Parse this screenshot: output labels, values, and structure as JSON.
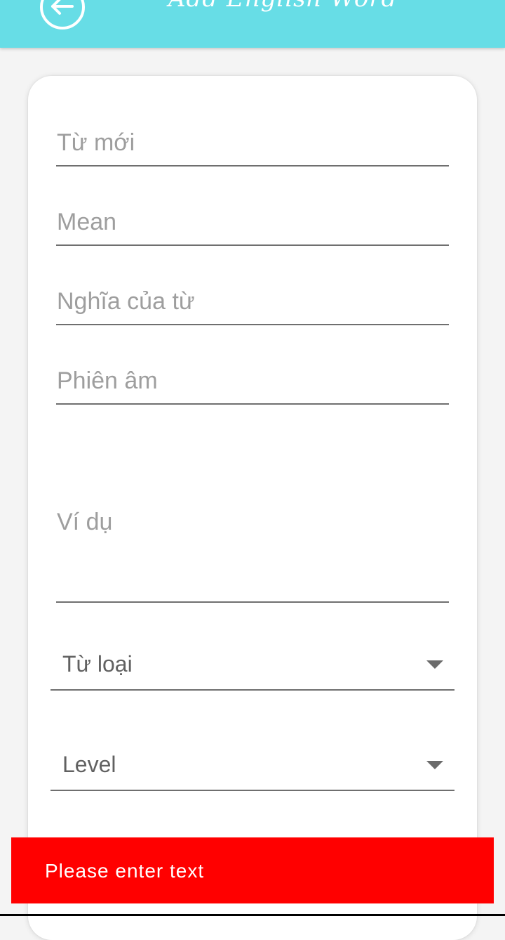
{
  "app_bar": {
    "title": "Add English Word",
    "back_icon": "arrow-left-circle-icon",
    "color": "#67dde6"
  },
  "form": {
    "word": {
      "placeholder": "Từ mới",
      "value": ""
    },
    "mean": {
      "placeholder": "Mean",
      "value": ""
    },
    "meaning": {
      "placeholder": "Nghĩa của từ",
      "value": ""
    },
    "phonetic": {
      "placeholder": "Phiên âm",
      "value": ""
    },
    "example": {
      "placeholder": "Ví dụ",
      "value": ""
    },
    "word_type": {
      "label": "Từ loại",
      "icon": "dropdown-arrow-icon"
    },
    "level": {
      "label": "Level",
      "icon": "dropdown-arrow-icon"
    }
  },
  "snackbar": {
    "message": "Please enter text",
    "color": "#ff0000"
  }
}
